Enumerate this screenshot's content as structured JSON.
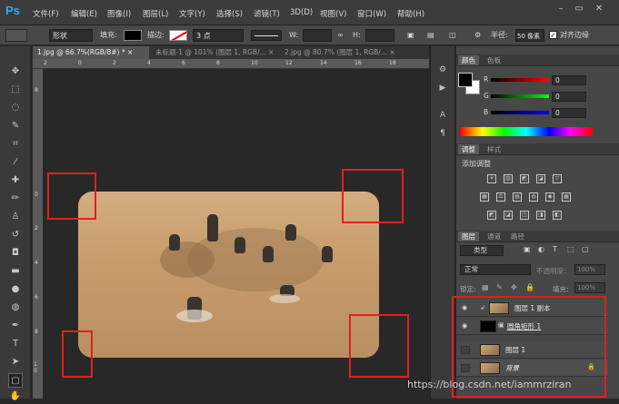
{
  "app": {
    "logo": "Ps"
  },
  "menu": [
    "文件(F)",
    "编辑(E)",
    "图像(I)",
    "图层(L)",
    "文字(Y)",
    "选择(S)",
    "滤镜(T)",
    "3D(D)",
    "视图(V)",
    "窗口(W)",
    "帮助(H)"
  ],
  "window_controls": [
    "–",
    "▭",
    "✕"
  ],
  "options": {
    "shape_mode": "形状",
    "fill_label": "填充:",
    "stroke_label": "描边:",
    "stroke_size": "3 点",
    "w_label": "W:",
    "h_label": "H:",
    "link_icon": "∞",
    "radius_label": "半径:",
    "radius_value": "50 像素",
    "align_edges_label": "对齐边缘",
    "align_edges_checked": true
  },
  "tabs": [
    {
      "label": "1.jpg @ 66.7%(RGB/8#) *",
      "close": "×",
      "active": true
    },
    {
      "label": "未标题-1 @ 101% (图层 1, RGB/...",
      "close": "×",
      "active": false
    },
    {
      "label": "2.jpg @ 80.7% (图层 1, RGB/...",
      "close": "×",
      "active": false
    }
  ],
  "ruler_h": [
    "2",
    "0",
    "2",
    "4",
    "6",
    "8",
    "10",
    "12",
    "14",
    "16",
    "18"
  ],
  "ruler_v": [
    "8",
    "0",
    "2",
    "4",
    "6",
    "8",
    "1 0"
  ],
  "color_panel": {
    "tabs": [
      "颜色",
      "色板"
    ],
    "r_label": "R",
    "r_value": "0",
    "g_label": "G",
    "g_value": "0",
    "b_label": "B",
    "b_value": "0"
  },
  "adjust_panel": {
    "tabs": [
      "调整",
      "样式"
    ],
    "title": "添加调整",
    "row1": [
      "☀",
      "▥",
      "◩",
      "◪",
      "▽"
    ],
    "row2": [
      "▦",
      "⚖",
      "▤",
      "◍",
      "◉",
      "▦"
    ],
    "row3": [
      "◩",
      "◪",
      "◫",
      "◨",
      "◧"
    ]
  },
  "layers_panel": {
    "tabs": [
      "图层",
      "通道",
      "路径"
    ],
    "filter_kind": "类型",
    "filter_icons": [
      "▣",
      "◐",
      "T",
      "⬚",
      "▢"
    ],
    "blend_mode": "正常",
    "opacity_label": "不透明度:",
    "opacity_value": "100%",
    "lock_label": "锁定:",
    "lock_icons": [
      "▦",
      "✎",
      "✥",
      "🔒"
    ],
    "fill_label": "填充:",
    "fill_value": "100%",
    "layers": [
      {
        "name": "图层 1 副本",
        "visible": true,
        "thumb": "photo"
      },
      {
        "name": "圆角矩形 1",
        "visible": true,
        "thumb": "black"
      },
      {
        "name": "图层 1",
        "visible": false,
        "thumb": "photo"
      },
      {
        "name": "背景",
        "visible": false,
        "thumb": "photo",
        "locked": true
      }
    ]
  },
  "side_icons": [
    "⚙",
    "▶",
    "A",
    "¶"
  ],
  "watermark": "https://blog.csdn.net/iammrziran",
  "colors": {
    "annotation": "#e02020",
    "ps_blue": "#31a8ff",
    "panel_bg": "#474747"
  }
}
